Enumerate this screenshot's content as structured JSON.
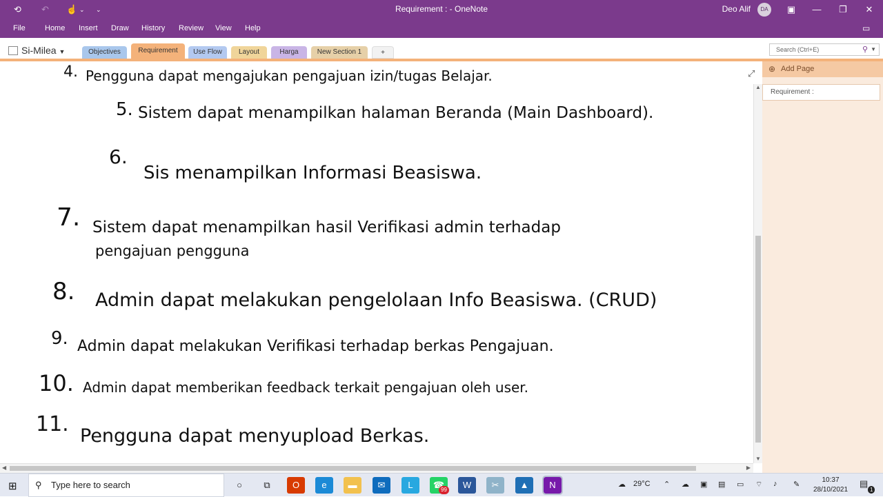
{
  "titlebar": {
    "title": "Requirement :  -  OneNote",
    "user_name": "Deo Alif",
    "user_initials": "DA",
    "back_icon": "back-arrow-icon",
    "undo_icon": "undo-icon",
    "touch_icon": "touch-mode-icon",
    "customize_icon": "customize-qat-icon"
  },
  "menu": {
    "items": [
      "File",
      "Home",
      "Insert",
      "Draw",
      "History",
      "Review",
      "View",
      "Help"
    ]
  },
  "notebook": {
    "name": "Si-Milea"
  },
  "sections": [
    {
      "label": "Objectives",
      "color": "#a9c7ec"
    },
    {
      "label": "Requirement",
      "color": "#f4b27a"
    },
    {
      "label": "Use Flow",
      "color": "#b3c9f0"
    },
    {
      "label": "Layout",
      "color": "#f0d59a"
    },
    {
      "label": "Harga",
      "color": "#c9b5e6"
    },
    {
      "label": "New Section 1",
      "color": "#e6d0a8"
    }
  ],
  "add_section_label": "+",
  "search": {
    "placeholder": "Search (Ctrl+E)"
  },
  "pages": {
    "add_label": "Add Page",
    "items": [
      "Requirement :"
    ]
  },
  "note_lines": [
    {
      "number": "4.",
      "text": "Pengguna dapat mengajukan pengajuan izin/tugas Belajar."
    },
    {
      "number": "5.",
      "text": "Sistem dapat menampilkan halaman Beranda (Main Dashboard)."
    },
    {
      "number": "6.",
      "text": "Sis  menampilkan Informasi Beasiswa."
    },
    {
      "number": "7.",
      "text": "Sistem dapat menampilkan hasil Verifikasi admin terhadap"
    },
    {
      "number": "",
      "text": "pengajuan pengguna"
    },
    {
      "number": "8.",
      "text": "Admin dapat melakukan pengelolaan Info Beasiswa. (CRUD)"
    },
    {
      "number": "9.",
      "text": "Admin dapat melakukan Verifikasi terhadap berkas Pengajuan."
    },
    {
      "number": "10.",
      "text": "Admin dapat memberikan feedback terkait pengajuan oleh user."
    },
    {
      "number": "11.",
      "text": "Pengguna dapat menyupload Berkas."
    }
  ],
  "taskbar": {
    "search_placeholder": "Type here to search",
    "apps": [
      {
        "name": "cortana-icon",
        "glyph": "○",
        "color": "#e4e8f2",
        "fg": "#222"
      },
      {
        "name": "task-view-icon",
        "glyph": "⧉",
        "color": "#e4e8f2",
        "fg": "#222"
      },
      {
        "name": "office-icon",
        "glyph": "O",
        "color": "#d83b01",
        "fg": "#fff"
      },
      {
        "name": "edge-icon",
        "glyph": "e",
        "color": "#1b8ad6",
        "fg": "#fff"
      },
      {
        "name": "file-explorer-icon",
        "glyph": "▬",
        "color": "#f2c14e",
        "fg": "#fff"
      },
      {
        "name": "mail-icon",
        "glyph": "✉",
        "color": "#0f6cbd",
        "fg": "#fff"
      },
      {
        "name": "l-app-icon",
        "glyph": "L",
        "color": "#28a8e0",
        "fg": "#fff"
      },
      {
        "name": "whatsapp-icon",
        "glyph": "☎",
        "color": "#25d366",
        "fg": "#fff"
      },
      {
        "name": "word-icon",
        "glyph": "W",
        "color": "#2b579a",
        "fg": "#fff"
      },
      {
        "name": "snipping-icon",
        "glyph": "✂",
        "color": "#8fb3c9",
        "fg": "#fff"
      },
      {
        "name": "photos-icon",
        "glyph": "▲",
        "color": "#1f6fb5",
        "fg": "#fff"
      },
      {
        "name": "onenote-icon",
        "glyph": "N",
        "color": "#7719aa",
        "fg": "#fff"
      }
    ],
    "whatsapp_badge": "99",
    "weather": "29°C",
    "time": "10:37",
    "date": "28/10/2021",
    "notification_count": "1"
  },
  "colors": {
    "brand": "#7b3a8c",
    "active_tab": "#f4b27a",
    "page_pane": "#faebde"
  }
}
